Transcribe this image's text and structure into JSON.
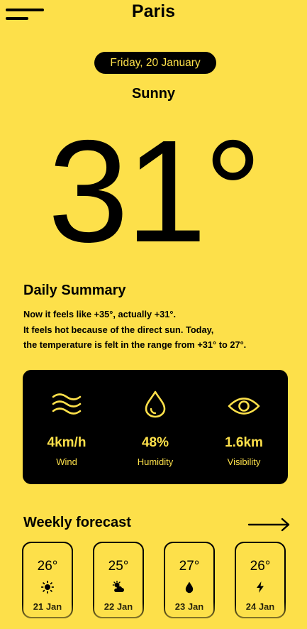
{
  "header": {
    "city": "Paris",
    "menu_icon": "hamburger-menu-icon"
  },
  "today": {
    "date": "Friday, 20 January",
    "condition": "Sunny",
    "temperature": "31°"
  },
  "summary": {
    "title": "Daily Summary",
    "lines": [
      "Now it feels like +35°, actually +31°.",
      "It feels hot because of the direct sun. Today,",
      "the temperature is felt in the range from +31° to 27°."
    ]
  },
  "stats": [
    {
      "icon": "wind-icon",
      "value": "4km/h",
      "label": "Wind"
    },
    {
      "icon": "humidity-drop-icon",
      "value": "48%",
      "label": "Humidity"
    },
    {
      "icon": "eye-icon",
      "value": "1.6km",
      "label": "Visibility"
    }
  ],
  "weekly": {
    "title": "Weekly forecast",
    "arrow_icon": "arrow-right-icon",
    "days": [
      {
        "temp": "26°",
        "icon": "sun-icon",
        "date": "21 Jan"
      },
      {
        "temp": "25°",
        "icon": "partly-cloudy-icon",
        "date": "22 Jan"
      },
      {
        "temp": "27°",
        "icon": "rain-drop-icon",
        "date": "23 Jan"
      },
      {
        "temp": "26°",
        "icon": "lightning-icon",
        "date": "24 Jan"
      }
    ]
  },
  "colors": {
    "background": "#fde04a",
    "foreground": "#000000"
  }
}
